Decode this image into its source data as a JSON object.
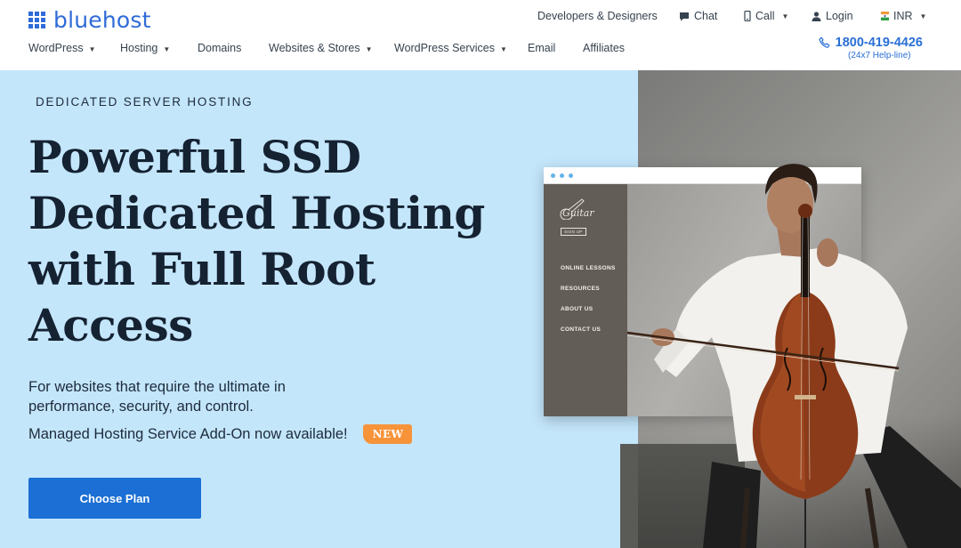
{
  "brand": {
    "name": "bluehost",
    "color": "#2f6bd8"
  },
  "top_links": {
    "developers": "Developers & Designers",
    "chat": "Chat",
    "call": "Call",
    "login": "Login",
    "currency": "INR"
  },
  "nav": {
    "items": [
      {
        "label": "WordPress",
        "dropdown": true
      },
      {
        "label": "Hosting",
        "dropdown": true
      },
      {
        "label": "Domains",
        "dropdown": false
      },
      {
        "label": "Websites & Stores",
        "dropdown": true
      },
      {
        "label": "WordPress Services",
        "dropdown": true
      },
      {
        "label": "Email",
        "dropdown": false
      },
      {
        "label": "Affiliates",
        "dropdown": false
      }
    ]
  },
  "phone": {
    "number": "1800-419-4426",
    "note": "(24x7 Help-line)"
  },
  "hero": {
    "eyebrow": "DEDICATED SERVER HOSTING",
    "headline_lines": [
      "Powerful SSD",
      "Dedicated Hosting",
      "with Full Root",
      "Access"
    ],
    "description": "For websites that require the ultimate in performance, security, and control.",
    "addon": "Managed Hosting Service Add-On now available!",
    "badge": "NEW",
    "cta": "Choose Plan",
    "background": "#c4e6fb",
    "cta_color": "#1b6fd5",
    "badge_color": "#f7943a"
  },
  "mockup": {
    "logo": "Guitar",
    "signup": "SIGN UP",
    "menu": [
      "ONLINE LESSONS",
      "RESOURCES",
      "ABOUT US",
      "CONTACT US"
    ]
  },
  "icons": {
    "chat": "chat-icon",
    "call": "phone-icon",
    "login": "user-icon",
    "currency": "india-flag-icon",
    "phone": "phone-handset-icon"
  }
}
